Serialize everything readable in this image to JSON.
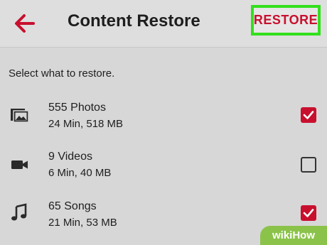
{
  "header": {
    "title": "Content Restore",
    "restore_label": "RESTORE",
    "back_icon": "arrow-left-icon"
  },
  "section_label": "Select what to restore.",
  "items": [
    {
      "icon": "photos-icon",
      "name": "555 Photos",
      "meta": "24 Min,  518 MB",
      "checked": true
    },
    {
      "icon": "video-camera-icon",
      "name": "9 Videos",
      "meta": "6 Min, 40 MB",
      "checked": false
    },
    {
      "icon": "music-note-icon",
      "name": "65 Songs",
      "meta": "21 Min, 53 MB",
      "checked": true
    }
  ],
  "watermark": "wikiHow",
  "colors": {
    "accent": "#c8102e",
    "highlight": "#32e01c",
    "background": "#d7d7d7"
  }
}
